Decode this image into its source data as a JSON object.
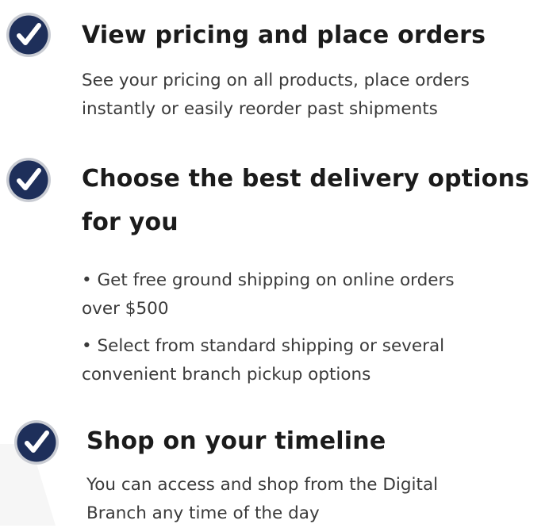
{
  "features": [
    {
      "icon": "check-circle-icon",
      "title": "View  pricing and place  orders",
      "lines": [
        "See your pricing on all products, place orders",
        "instantly  or easily reorder past  shipments"
      ]
    },
    {
      "icon": "check-circle-icon",
      "title_lines": [
        "Choose the best delivery options",
        "for  you"
      ],
      "bullets": [
        {
          "lines": [
            "• Get free ground shipping on online orders",
            "over  $500"
          ]
        },
        {
          "lines": [
            "• Select from standard shipping or several",
            "convenient branch  pickup  options"
          ]
        }
      ]
    },
    {
      "icon": "check-circle-icon",
      "title": "Shop on your timeline",
      "lines": [
        "You can access and shop from the Digital",
        "Branch any time of the  day"
      ]
    }
  ],
  "colors": {
    "icon_fill": "#1e2f5a",
    "icon_ring": "#c9ccd3",
    "icon_check": "#ffffff",
    "title": "#1b1b1b",
    "body": "#3a3a3a"
  }
}
